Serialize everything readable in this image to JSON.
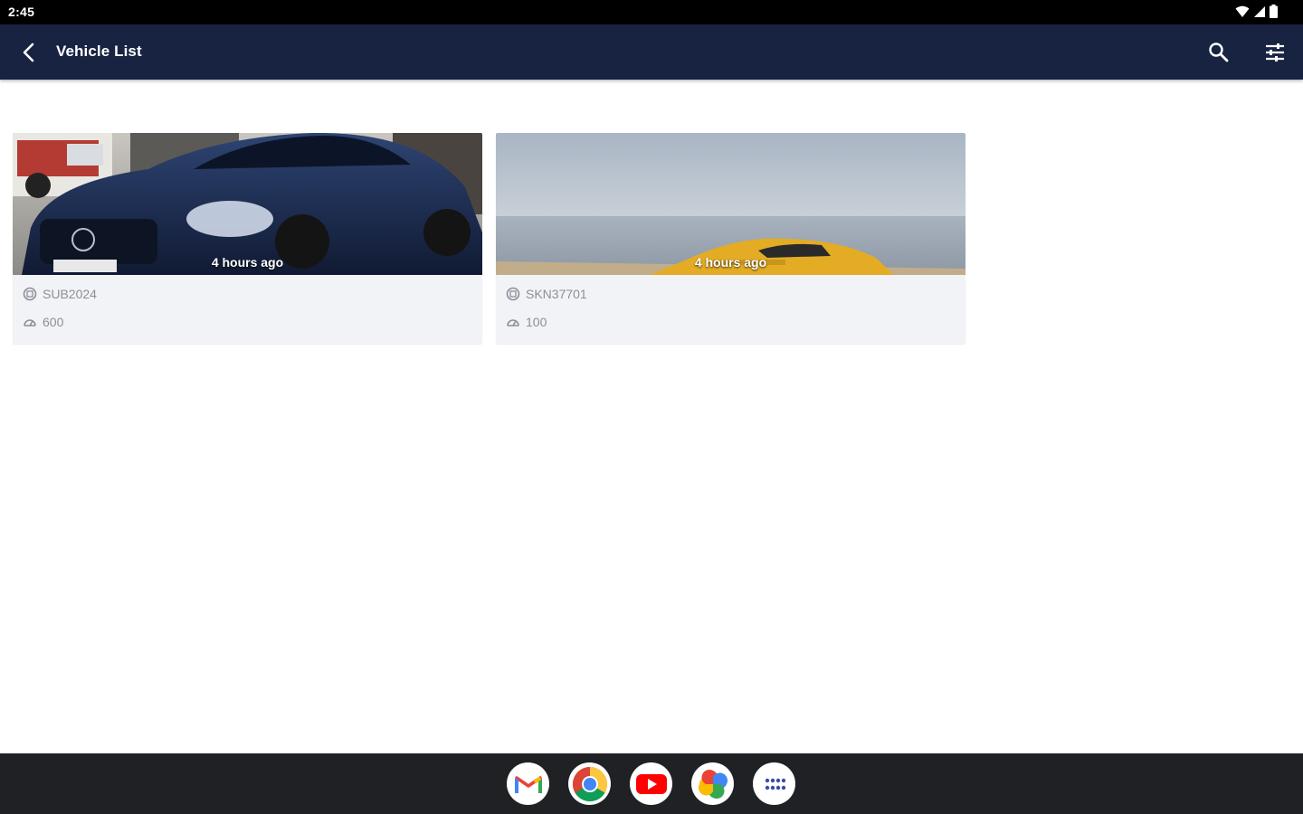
{
  "status_bar": {
    "time": "2:45",
    "icons": [
      "wifi-icon",
      "cell-signal-icon",
      "battery-icon"
    ]
  },
  "app_bar": {
    "title": "Vehicle List",
    "back_icon": "back-arrow-icon",
    "actions": [
      "search-icon",
      "filter-settings-icon"
    ],
    "background": "#172341"
  },
  "vehicles": [
    {
      "timestamp": "4 hours ago",
      "plate": "SUB2024",
      "odometer": "600",
      "image": "dark-blue-sports-car-photo"
    },
    {
      "timestamp": "4 hours ago",
      "plate": "SKN37701",
      "odometer": "100",
      "image": "yellow-sports-car-by-sea-photo"
    }
  ],
  "taskbar": {
    "apps": [
      "gmail-icon",
      "chrome-icon",
      "youtube-icon",
      "photos-icon",
      "app-drawer-icon"
    ]
  }
}
